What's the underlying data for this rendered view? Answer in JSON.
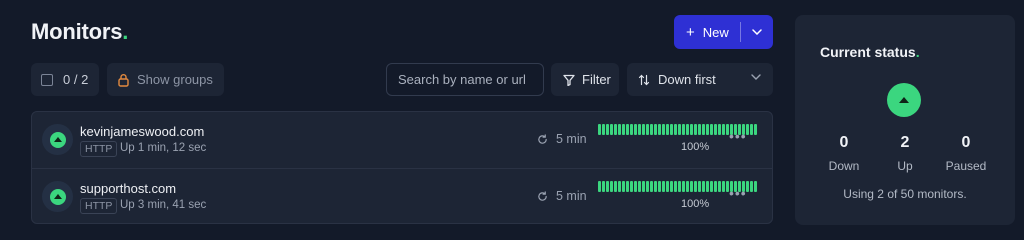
{
  "header": {
    "title": "Monitors",
    "title_dot": "."
  },
  "new_button": {
    "label": "New",
    "plus_icon": "plus-icon",
    "caret_icon": "chevron-down-icon"
  },
  "toolbar": {
    "selection_count": "0 / 2",
    "show_groups_label": "Show groups",
    "search_placeholder": "Search by name or url",
    "filter_label": "Filter",
    "sort_label": "Down first"
  },
  "monitors": [
    {
      "name": "kevinjameswood.com",
      "type": "HTTP",
      "uptime": "Up 1 min, 12 sec",
      "interval": "5 min",
      "uptime_percent": "100%",
      "status": "up",
      "heartbeat_count": 40
    },
    {
      "name": "supporthost.com",
      "type": "HTTP",
      "uptime": "Up 3 min, 41 sec",
      "interval": "5 min",
      "uptime_percent": "100%",
      "status": "up",
      "heartbeat_count": 40
    }
  ],
  "status_panel": {
    "title": "Current status",
    "title_dot": ".",
    "down": {
      "count": "0",
      "label": "Down"
    },
    "up": {
      "count": "2",
      "label": "Up"
    },
    "paused": {
      "count": "0",
      "label": "Paused"
    },
    "usage": "Using 2 of 50 monitors."
  },
  "colors": {
    "accent": "#2e30d4",
    "up_green": "#3bd67f",
    "background": "#131a29",
    "panel": "#1d2535"
  }
}
